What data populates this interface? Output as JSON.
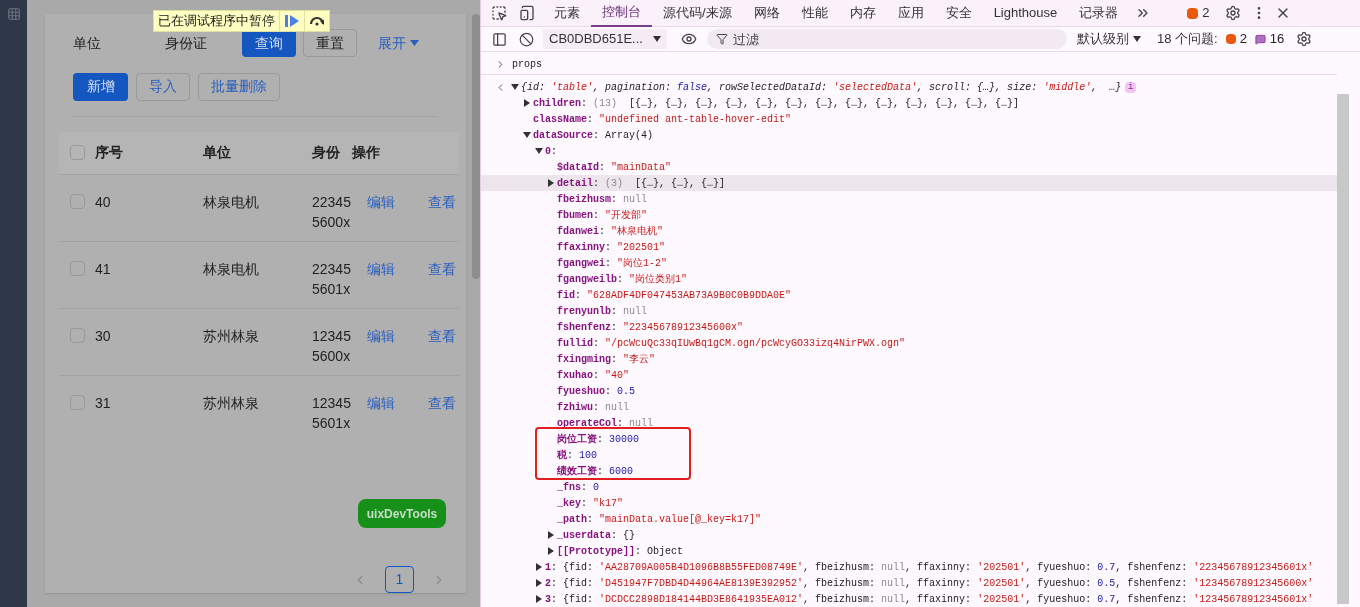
{
  "debug_banner": {
    "text": "已在调试程序中暂停"
  },
  "filters": [
    {
      "label": "单位"
    },
    {
      "label": "身份证"
    }
  ],
  "search_button": "查询",
  "reset_button": "重置",
  "expand_link": "展开",
  "actions": [
    {
      "label": "新增",
      "kind": "primary"
    },
    {
      "label": "导入",
      "kind": "link"
    },
    {
      "label": "批量删除",
      "kind": "link"
    }
  ],
  "table": {
    "all_checked": false,
    "columns": [
      "序号",
      "单位",
      "身份",
      "操作"
    ],
    "rows": [
      {
        "checked": false,
        "cells": [
          "40",
          "林泉电机",
          "22345 5600x"
        ],
        "actions": [
          "编辑",
          "查看"
        ]
      },
      {
        "checked": false,
        "cells": [
          "41",
          "林泉电机",
          "22345 5601x"
        ],
        "actions": [
          "编辑",
          "查看"
        ]
      },
      {
        "checked": false,
        "cells": [
          "30",
          "苏州林泉",
          "12345 5600x"
        ],
        "actions": [
          "编辑",
          "查看"
        ]
      },
      {
        "checked": false,
        "cells": [
          "31",
          "苏州林泉",
          "12345 5601x"
        ],
        "actions": [
          "编辑",
          "查看"
        ]
      }
    ]
  },
  "floating_button": "uixDevTools",
  "pagination": {
    "pages": [
      {
        "label": "1",
        "selected": true
      }
    ]
  },
  "devtools": {
    "tabs": [
      {
        "label": "元素",
        "selected": false
      },
      {
        "label": "控制台",
        "selected": true
      },
      {
        "label": "源代码/来源",
        "selected": false
      },
      {
        "label": "网络",
        "selected": false
      },
      {
        "label": "性能",
        "selected": false
      },
      {
        "label": "内存",
        "selected": false
      },
      {
        "label": "应用",
        "selected": false
      },
      {
        "label": "安全",
        "selected": false
      },
      {
        "label": "Lighthouse",
        "selected": false
      },
      {
        "label": "记录器",
        "selected": false
      }
    ],
    "issues_badge": "2",
    "toolbar": {
      "context": "CB0DBD651E...",
      "filter_placeholder": "过滤",
      "level": "默认级别",
      "issues_label": "18 个问题:",
      "warnings": "2",
      "infos": "16"
    },
    "console": {
      "input": "props",
      "result": {
        "expanded": true,
        "info_badge": "i",
        "preview": [
          {
            "text": "{id: ",
            "kind": "punct"
          },
          {
            "text": "'table'",
            "kind": "string"
          },
          {
            "text": ", pagination: ",
            "kind": "punct"
          },
          {
            "text": "false",
            "kind": "number"
          },
          {
            "text": ", rowSelectedDataId: ",
            "kind": "punct"
          },
          {
            "text": "'selectedData'",
            "kind": "string"
          },
          {
            "text": ", scroll: {…}, size: ",
            "kind": "punct"
          },
          {
            "text": "'middle'",
            "kind": "string"
          },
          {
            "text": ",  …}",
            "kind": "punct"
          }
        ],
        "children": [
          {
            "key": "children",
            "kind": "expandable",
            "expanded": false,
            "value": [
              {
                "text": ": ",
                "kind": "punct"
              },
              {
                "text": "(13)",
                "kind": "null"
              },
              {
                "text": "  [{…}, {…}, {…}, {…}, {…}, {…}, {…}, {…}, {…}, {…}, {…}, {…}, {…}]",
                "kind": "punct"
              }
            ]
          },
          {
            "key": "className",
            "kind": "leaf",
            "value": [
              {
                "text": ": ",
                "kind": "punct"
              },
              {
                "text": "\"undefined ant-table-hover-edit\"",
                "kind": "string"
              }
            ]
          },
          {
            "key": "dataSource",
            "kind": "expandable",
            "expanded": true,
            "value": [
              {
                "text": ": ",
                "kind": "punct"
              },
              {
                "text": "Array(4)",
                "kind": "punct"
              }
            ],
            "children": [
              {
                "key": "0",
                "kind": "expandable",
                "expanded": true,
                "value": [
                  {
                    "text": ":",
                    "kind": "punct"
                  }
                ],
                "children": [
                  {
                    "key": "$dataId",
                    "kind": "leaf",
                    "hovered": false,
                    "value": [
                      {
                        "text": ": ",
                        "kind": "punct"
                      },
                      {
                        "text": "\"mainData\"",
                        "kind": "string"
                      }
                    ]
                  },
                  {
                    "key": "detail",
                    "kind": "expandable",
                    "expanded": false,
                    "hovered": true,
                    "value": [
                      {
                        "text": ": ",
                        "kind": "punct"
                      },
                      {
                        "text": "(3)",
                        "kind": "null"
                      },
                      {
                        "text": "  [{…}, {…}, {…}]",
                        "kind": "punct"
                      }
                    ]
                  },
                  {
                    "key": "fbeizhusm",
                    "kind": "leaf",
                    "hovered": false,
                    "value": [
                      {
                        "text": ": ",
                        "kind": "punct"
                      },
                      {
                        "text": "null",
                        "kind": "null"
                      }
                    ]
                  },
                  {
                    "key": "fbumen",
                    "kind": "leaf",
                    "hovered": false,
                    "value": [
                      {
                        "text": ": ",
                        "kind": "punct"
                      },
                      {
                        "text": "\"开发部\"",
                        "kind": "string"
                      }
                    ]
                  },
                  {
                    "key": "fdanwei",
                    "kind": "leaf",
                    "hovered": false,
                    "value": [
                      {
                        "text": ": ",
                        "kind": "punct"
                      },
                      {
                        "text": "\"林泉电机\"",
                        "kind": "string"
                      }
                    ]
                  },
                  {
                    "key": "ffaxinny",
                    "kind": "leaf",
                    "hovered": false,
                    "value": [
                      {
                        "text": ": ",
                        "kind": "punct"
                      },
                      {
                        "text": "\"202501\"",
                        "kind": "string"
                      }
                    ]
                  },
                  {
                    "key": "fgangwei",
                    "kind": "leaf",
                    "hovered": false,
                    "value": [
                      {
                        "text": ": ",
                        "kind": "punct"
                      },
                      {
                        "text": "\"岗位1-2\"",
                        "kind": "string"
                      }
                    ]
                  },
                  {
                    "key": "fgangweilb",
                    "kind": "leaf",
                    "hovered": false,
                    "value": [
                      {
                        "text": ": ",
                        "kind": "punct"
                      },
                      {
                        "text": "\"岗位类别1\"",
                        "kind": "string"
                      }
                    ]
                  },
                  {
                    "key": "fid",
                    "kind": "leaf",
                    "hovered": false,
                    "value": [
                      {
                        "text": ": ",
                        "kind": "punct"
                      },
                      {
                        "text": "\"628ADF4DF047453AB73A9B0C0B9DDA0E\"",
                        "kind": "string"
                      }
                    ]
                  },
                  {
                    "key": "frenyunlb",
                    "kind": "leaf",
                    "hovered": false,
                    "value": [
                      {
                        "text": ": ",
                        "kind": "punct"
                      },
                      {
                        "text": "null",
                        "kind": "null"
                      }
                    ]
                  },
                  {
                    "key": "fshenfenz",
                    "kind": "leaf",
                    "hovered": false,
                    "value": [
                      {
                        "text": ": ",
                        "kind": "punct"
                      },
                      {
                        "text": "\"22345678912345600x\"",
                        "kind": "string"
                      }
                    ]
                  },
                  {
                    "key": "fullid",
                    "kind": "leaf",
                    "hovered": false,
                    "value": [
                      {
                        "text": ": ",
                        "kind": "punct"
                      },
                      {
                        "text": "\"/pcWcuQc33qIUwBq1gCM.ogn/pcWcyGO33izq4NirPWX.ogn\"",
                        "kind": "string"
                      }
                    ]
                  },
                  {
                    "key": "fxingming",
                    "kind": "leaf",
                    "hovered": false,
                    "value": [
                      {
                        "text": ": ",
                        "kind": "punct"
                      },
                      {
                        "text": "\"李云\"",
                        "kind": "string"
                      }
                    ]
                  },
                  {
                    "key": "fxuhao",
                    "kind": "leaf",
                    "hovered": false,
                    "value": [
                      {
                        "text": ": ",
                        "kind": "punct"
                      },
                      {
                        "text": "\"40\"",
                        "kind": "string"
                      }
                    ]
                  },
                  {
                    "key": "fyueshuo",
                    "kind": "leaf",
                    "hovered": false,
                    "value": [
                      {
                        "text": ": ",
                        "kind": "punct"
                      },
                      {
                        "text": "0.5",
                        "kind": "number"
                      }
                    ]
                  },
                  {
                    "key": "fzhiwu",
                    "kind": "leaf",
                    "hovered": false,
                    "value": [
                      {
                        "text": ": ",
                        "kind": "punct"
                      },
                      {
                        "text": "null",
                        "kind": "null"
                      }
                    ]
                  },
                  {
                    "key": "operateCol",
                    "kind": "leaf",
                    "hovered": false,
                    "value": [
                      {
                        "text": ": ",
                        "kind": "punct"
                      },
                      {
                        "text": "null",
                        "kind": "null"
                      }
                    ]
                  },
                  {
                    "key": "岗位工资",
                    "kind": "leaf",
                    "hovered": false,
                    "value": [
                      {
                        "text": ": ",
                        "kind": "punct"
                      },
                      {
                        "text": "30000",
                        "kind": "number"
                      }
                    ]
                  },
                  {
                    "key": "税",
                    "kind": "leaf",
                    "hovered": false,
                    "value": [
                      {
                        "text": ": ",
                        "kind": "punct"
                      },
                      {
                        "text": "100",
                        "kind": "number"
                      }
                    ]
                  },
                  {
                    "key": "绩效工资",
                    "kind": "leaf",
                    "hovered": false,
                    "value": [
                      {
                        "text": ": ",
                        "kind": "punct"
                      },
                      {
                        "text": "6000",
                        "kind": "number"
                      }
                    ]
                  },
                  {
                    "key": "_fns",
                    "kind": "leaf",
                    "hovered": false,
                    "value": [
                      {
                        "text": ": ",
                        "kind": "punct"
                      },
                      {
                        "text": "0",
                        "kind": "number"
                      }
                    ]
                  },
                  {
                    "key": "_key",
                    "kind": "leaf",
                    "hovered": false,
                    "value": [
                      {
                        "text": ": ",
                        "kind": "punct"
                      },
                      {
                        "text": "\"k17\"",
                        "kind": "string"
                      }
                    ]
                  },
                  {
                    "key": "_path",
                    "kind": "leaf",
                    "hovered": false,
                    "value": [
                      {
                        "text": ": ",
                        "kind": "punct"
                      },
                      {
                        "text": "\"mainData.value[@_key=k17]\"",
                        "kind": "string"
                      }
                    ]
                  },
                  {
                    "key": "_userdata",
                    "kind": "expandable",
                    "expanded": false,
                    "hovered": false,
                    "value": [
                      {
                        "text": ": ",
                        "kind": "punct"
                      },
                      {
                        "text": "{}",
                        "kind": "punct"
                      }
                    ]
                  },
                  {
                    "key": "[[Prototype]]",
                    "kind": "expandable",
                    "expanded": false,
                    "hovered": false,
                    "value": [
                      {
                        "text": ": ",
                        "kind": "punct"
                      },
                      {
                        "text": "Object",
                        "kind": "punct"
                      }
                    ]
                  }
                ]
              },
              {
                "key": "1",
                "kind": "expandable",
                "expanded": false,
                "value": [
                  {
                    "text": ": {fid: ",
                    "kind": "punct"
                  },
                  {
                    "text": "'AA28709A005B4D1096B8B55FED08749E'",
                    "kind": "string"
                  },
                  {
                    "text": ", fbeizhusm: ",
                    "kind": "punct"
                  },
                  {
                    "text": "null",
                    "kind": "null"
                  },
                  {
                    "text": ", ffaxinny: ",
                    "kind": "punct"
                  },
                  {
                    "text": "'202501'",
                    "kind": "string"
                  },
                  {
                    "text": ", fyueshuo: ",
                    "kind": "punct"
                  },
                  {
                    "text": "0.7",
                    "kind": "number"
                  },
                  {
                    "text": ", fshenfenz: ",
                    "kind": "punct"
                  },
                  {
                    "text": "'22345678912345601x'",
                    "kind": "string"
                  }
                ]
              },
              {
                "key": "2",
                "kind": "expandable",
                "expanded": false,
                "value": [
                  {
                    "text": ": {fid: ",
                    "kind": "punct"
                  },
                  {
                    "text": "'D451947F7DBD4D44964AE8139E392952'",
                    "kind": "string"
                  },
                  {
                    "text": ", fbeizhusm: ",
                    "kind": "punct"
                  },
                  {
                    "text": "null",
                    "kind": "null"
                  },
                  {
                    "text": ", ffaxinny: ",
                    "kind": "punct"
                  },
                  {
                    "text": "'202501'",
                    "kind": "string"
                  },
                  {
                    "text": ", fyueshuo: ",
                    "kind": "punct"
                  },
                  {
                    "text": "0.5",
                    "kind": "number"
                  },
                  {
                    "text": ", fshenfenz: ",
                    "kind": "punct"
                  },
                  {
                    "text": "'12345678912345600x'",
                    "kind": "string"
                  }
                ]
              },
              {
                "key": "3",
                "kind": "expandable",
                "expanded": false,
                "value": [
                  {
                    "text": ": {fid: ",
                    "kind": "punct"
                  },
                  {
                    "text": "'DCDCC2898D184144BD3E8641935EA012'",
                    "kind": "string"
                  },
                  {
                    "text": ", fbeizhusm: ",
                    "kind": "punct"
                  },
                  {
                    "text": "null",
                    "kind": "null"
                  },
                  {
                    "text": ", ffaxinny: ",
                    "kind": "punct"
                  },
                  {
                    "text": "'202501'",
                    "kind": "string"
                  },
                  {
                    "text": ", fyueshuo: ",
                    "kind": "punct"
                  },
                  {
                    "text": "0.7",
                    "kind": "number"
                  },
                  {
                    "text": ", fshenfenz: ",
                    "kind": "punct"
                  },
                  {
                    "text": "'12345678912345601x'",
                    "kind": "string"
                  }
                ]
              }
            ]
          }
        ]
      }
    }
  }
}
